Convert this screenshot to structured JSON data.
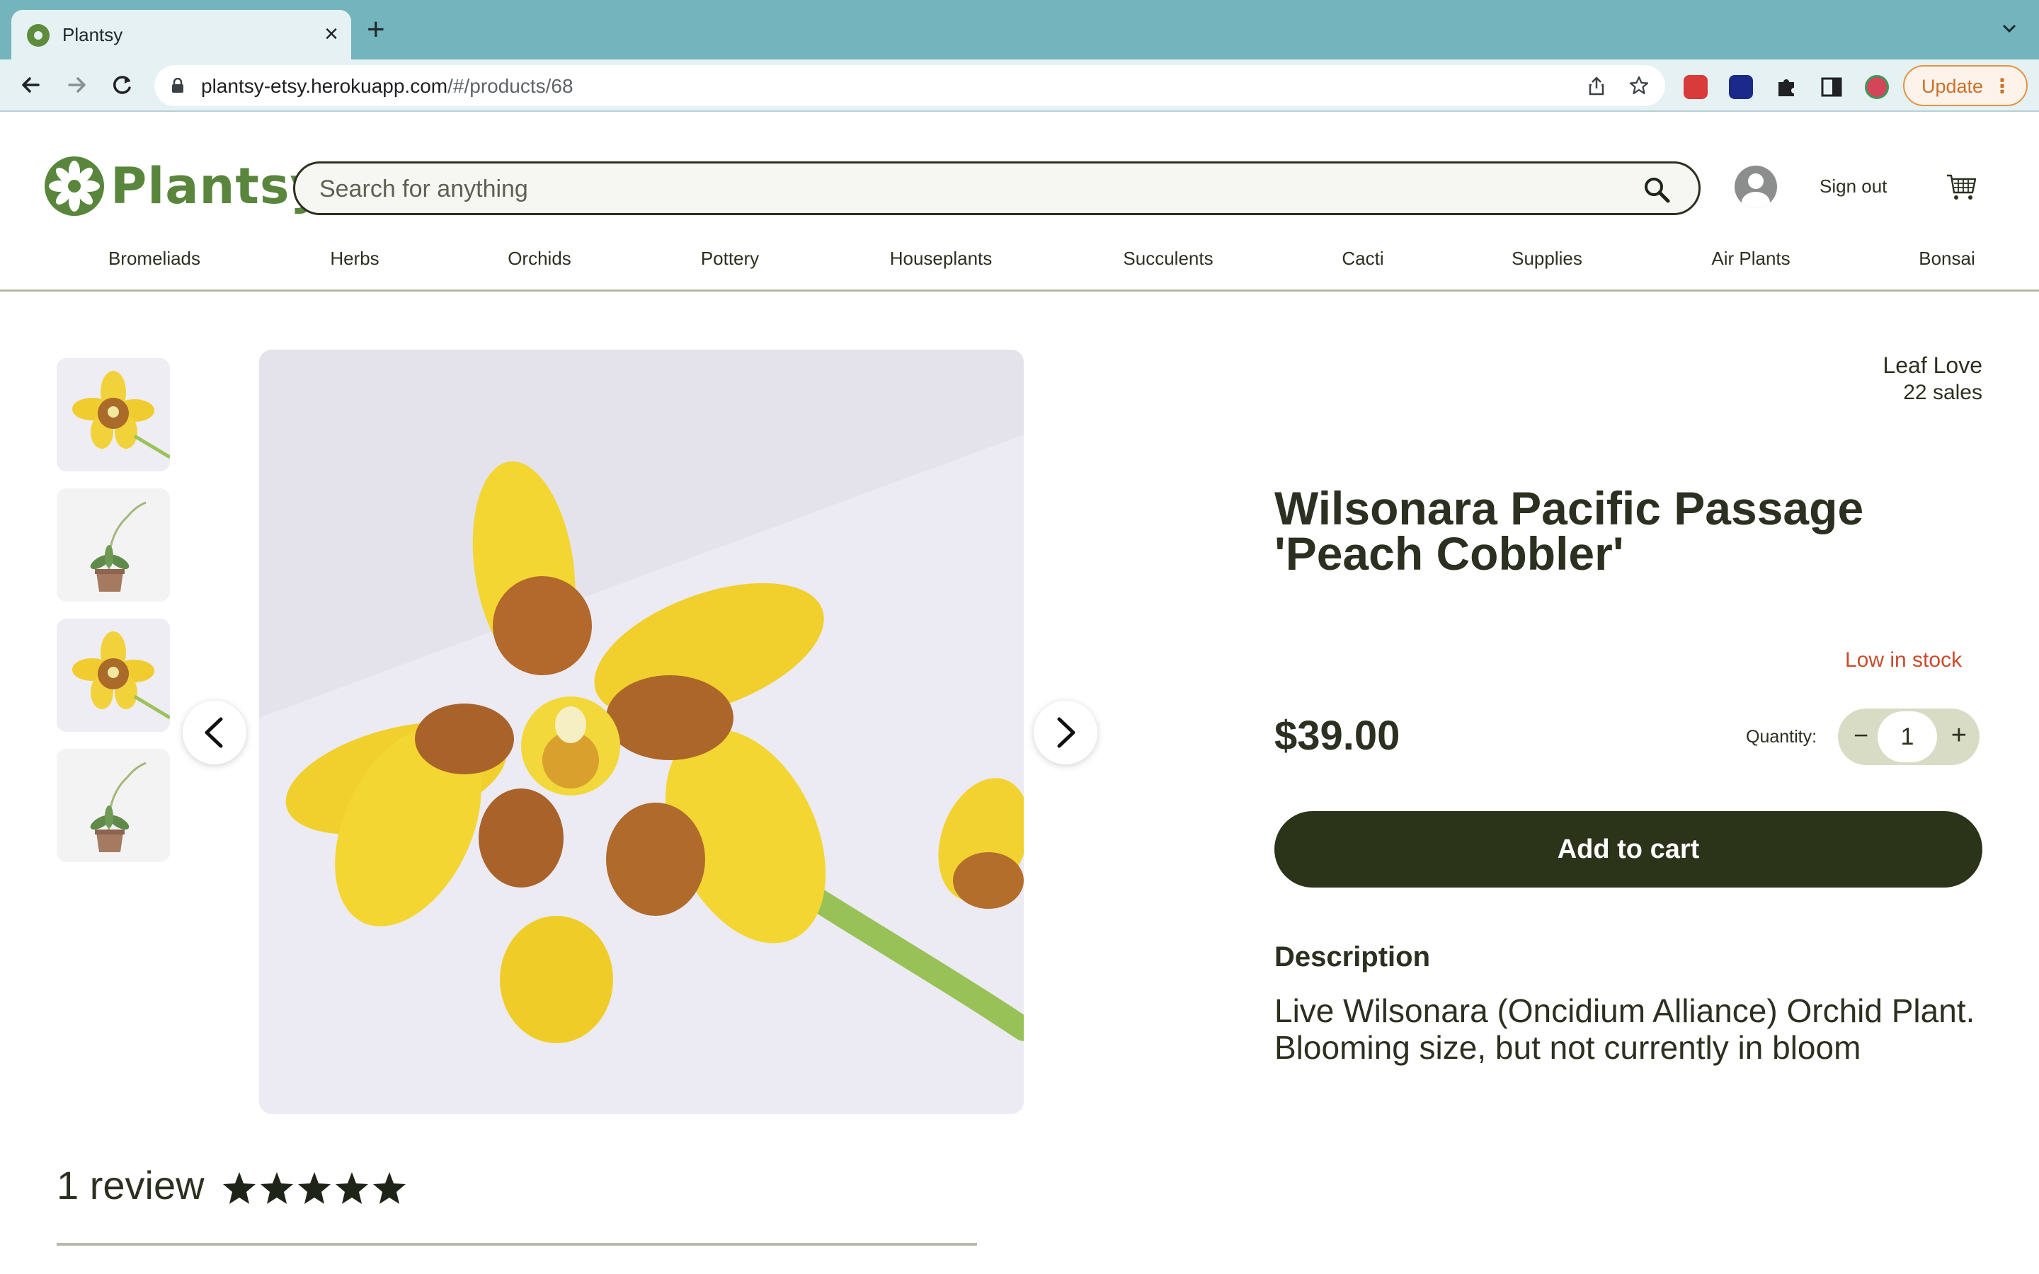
{
  "browser": {
    "tab_title": "Plantsy",
    "url_host": "plantsy-etsy.herokuapp.com",
    "url_path": "/#/products/68",
    "update_label": "Update",
    "icons": [
      "back-arrow-icon",
      "forward-arrow-icon",
      "reload-icon",
      "lock-icon",
      "share-icon",
      "bookmark-star-icon",
      "extension-puzzle-icon",
      "sidebar-icon",
      "profile-icon",
      "more-vert-icon"
    ]
  },
  "site": {
    "logo_text": "Plantsy",
    "search_placeholder": "Search for anything",
    "sign_out": "Sign out",
    "categories": [
      "Bromeliads",
      "Herbs",
      "Orchids",
      "Pottery",
      "Houseplants",
      "Succulents",
      "Cacti",
      "Supplies",
      "Air Plants",
      "Bonsai"
    ]
  },
  "product": {
    "shop_name": "Leaf Love",
    "shop_sales": "22 sales",
    "title": "Wilsonara Pacific Passage 'Peach Cobbler'",
    "stock_status": "Low in stock",
    "price": "$39.00",
    "quantity_label": "Quantity:",
    "quantity_value": "1",
    "qty_minus": "−",
    "qty_plus": "+",
    "add_to_cart": "Add to cart",
    "description_heading": "Description",
    "description": "Live Wilsonara (Oncidium Alliance) Orchid Plant. Blooming size, but not currently in bloom"
  },
  "reviews": {
    "count_label": "1 review",
    "rating": 5,
    "rating_max": 5
  },
  "colors": {
    "brand_green": "#59863c",
    "dark": "#2b3020",
    "button_dark": "#2b3319",
    "stock_red": "#c94c2e",
    "chrome_teal": "#74b4bd"
  }
}
